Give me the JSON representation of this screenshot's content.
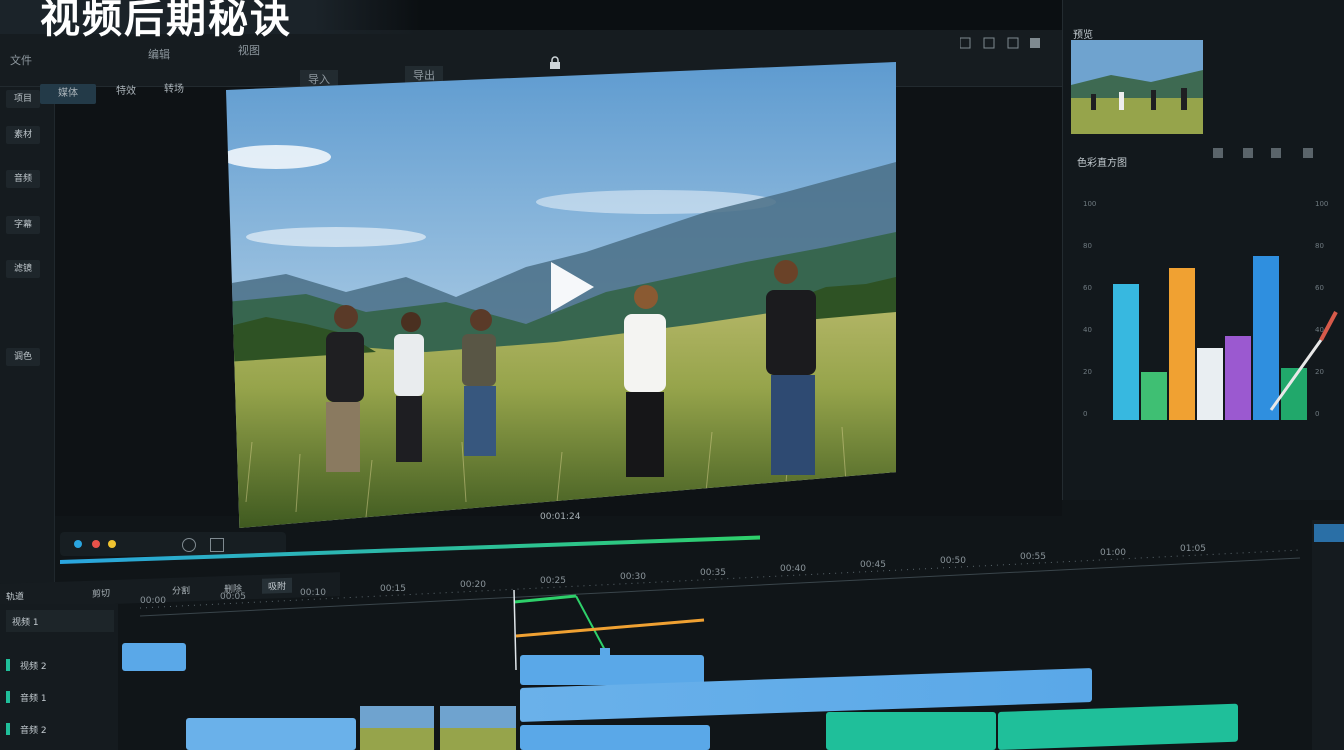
{
  "overlay_title": "视频后期秘诀",
  "top_menu": [
    "文件",
    "编辑",
    "视图"
  ],
  "viewer_toolbar": [
    "导入",
    "导出"
  ],
  "viewer_tabs": [
    "媒体",
    "特效",
    "转场"
  ],
  "left_strip": [
    "项目",
    "素材",
    "音频",
    "字幕",
    "滤镜",
    "调色"
  ],
  "playback_timecode": "00:01:24",
  "timeline_toolbar": [
    "轨道",
    "剪切",
    "分割",
    "删除",
    "吸附"
  ],
  "timeline_ruler": [
    "00:00",
    "00:05",
    "00:10",
    "00:15",
    "00:20",
    "00:25",
    "00:30",
    "00:35",
    "00:40",
    "00:45",
    "00:50",
    "00:55",
    "01:00",
    "01:05"
  ],
  "tracks": [
    "视频 1",
    "视频 2",
    "音频 1",
    "音频 2"
  ],
  "right_panel": {
    "title": "预览",
    "section": "色彩直方图",
    "scale_left": [
      "100",
      "80",
      "60",
      "40",
      "20",
      "0"
    ],
    "scale_right": [
      "100",
      "80",
      "60",
      "40",
      "20",
      "0"
    ],
    "histogram_bars": [
      {
        "color": "#37b8e0",
        "value": 0.68
      },
      {
        "color": "#3fbf73",
        "value": 0.24
      },
      {
        "color": "#f0a132",
        "value": 0.76
      },
      {
        "color": "#e9eef2",
        "value": 0.36
      },
      {
        "color": "#9b59d0",
        "value": 0.42
      },
      {
        "color": "#2f8fdf",
        "value": 0.82
      },
      {
        "color": "#21a86b",
        "value": 0.26
      }
    ]
  },
  "colors": {
    "accent": "#2aa5e0",
    "keyframe": "#2ed06a",
    "clip_blue": "#5aa8e8",
    "clip_teal": "#1fbf9a"
  }
}
